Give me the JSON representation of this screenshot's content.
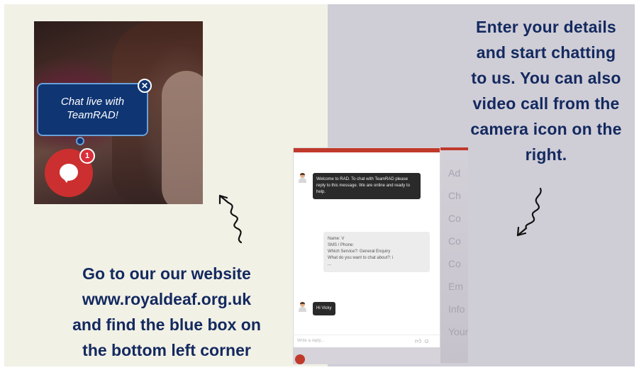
{
  "left_caption": {
    "line1": "Go to our our website",
    "line2": "www.royaldeaf.org.uk",
    "line3": "and find the blue box on",
    "line4": "the bottom left corner"
  },
  "right_caption": {
    "line1": "Enter your details",
    "line2": "and start chatting",
    "line3": "to us. You can also",
    "line4": "video call  from the",
    "line5": "camera icon on the",
    "line6": "right."
  },
  "launcher": {
    "bubble_line1": "Chat live with",
    "bubble_line2": "TeamRAD!",
    "close_symbol": "✕",
    "badge_count": "1",
    "icon": "chat-bubble-icon"
  },
  "chat_window": {
    "welcome_message": "Welcome to RAD. To chat with TeamRAD please reply to this message. We are online and ready to help.",
    "form_lines": [
      "Name: V",
      "SMS / Phone:",
      "Which Service?: General Enquiry",
      "What do you want to chat about?: i",
      "..."
    ],
    "user_message": "Hi Vicky",
    "reply_placeholder": "Write a reply...",
    "reply_icons": [
      "thumbs-up-icon",
      "emoji-icon"
    ],
    "accent": "#c0392b"
  },
  "background_menu": {
    "items": [
      "Ad",
      "Ch",
      "Co",
      "Co",
      "Co",
      "Em",
      "Info",
      "Your"
    ]
  },
  "colors": {
    "left_panel": "#f2f1e6",
    "right_panel": "#cfcdd6",
    "caption_text": "#13295f",
    "bubble": "#0f3573",
    "launcher": "#cc2f2f"
  }
}
